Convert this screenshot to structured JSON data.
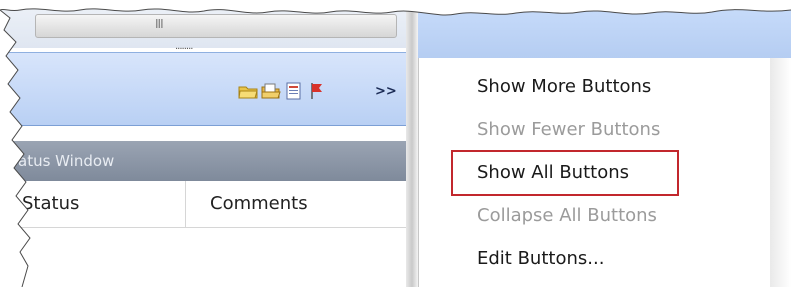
{
  "status_window": {
    "title": "atus Window",
    "columns": [
      "Status",
      "Comments"
    ]
  },
  "toolbar": {
    "overflow_label": ">>",
    "scroll_grip": "III",
    "grip": "........"
  },
  "menu": {
    "items": [
      {
        "label": "Show More Buttons",
        "enabled": true
      },
      {
        "label": "Show Fewer Buttons",
        "enabled": false
      },
      {
        "label": "Show All Buttons",
        "enabled": true,
        "highlighted": true
      },
      {
        "label": "Collapse All Buttons",
        "enabled": false
      },
      {
        "label": "Edit Buttons...",
        "enabled": true
      }
    ]
  },
  "colors": {
    "toolbar": "#c7dbfa",
    "status_header": "#8c97a8",
    "highlight": "#c2272d",
    "disabled_text": "#9b9b9b"
  },
  "icons": [
    "folder-icon",
    "open-folder-icon",
    "document-icon",
    "flag-icon"
  ]
}
